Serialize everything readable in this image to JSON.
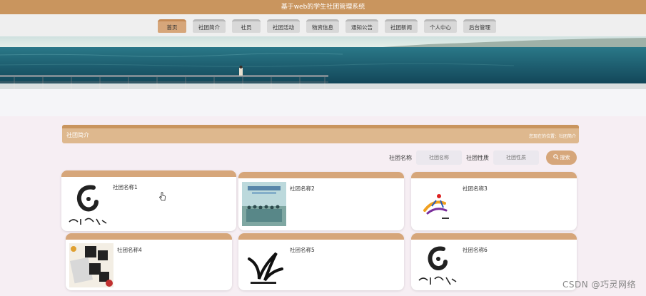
{
  "app": {
    "title": "基于web的学生社团管理系统"
  },
  "nav": [
    {
      "label": "首页",
      "active": true
    },
    {
      "label": "社团简介"
    },
    {
      "label": "社员"
    },
    {
      "label": "社团活动"
    },
    {
      "label": "物资信息"
    },
    {
      "label": "通知公告"
    },
    {
      "label": "社团新闻"
    },
    {
      "label": "个人中心"
    },
    {
      "label": "后台管理"
    }
  ],
  "section": {
    "title": "社团简介",
    "breadcrumb": "您现在的位置：社团简介"
  },
  "search": {
    "name_label": "社团名称",
    "name_placeholder": "社团名称",
    "type_label": "社团性质",
    "type_placeholder": "社团性质",
    "button_label": "搜索"
  },
  "clubs": [
    {
      "name": "社团名称1"
    },
    {
      "name": "社团名称2"
    },
    {
      "name": "社团名称3"
    },
    {
      "name": "社团名称4"
    },
    {
      "name": "社团名称5"
    },
    {
      "name": "社团名称6"
    }
  ],
  "watermark": "CSDN @巧灵网络",
  "colors": {
    "accent": "#c9955e",
    "tab_active": "#d6a67a",
    "tab": "#d8d8d8"
  }
}
